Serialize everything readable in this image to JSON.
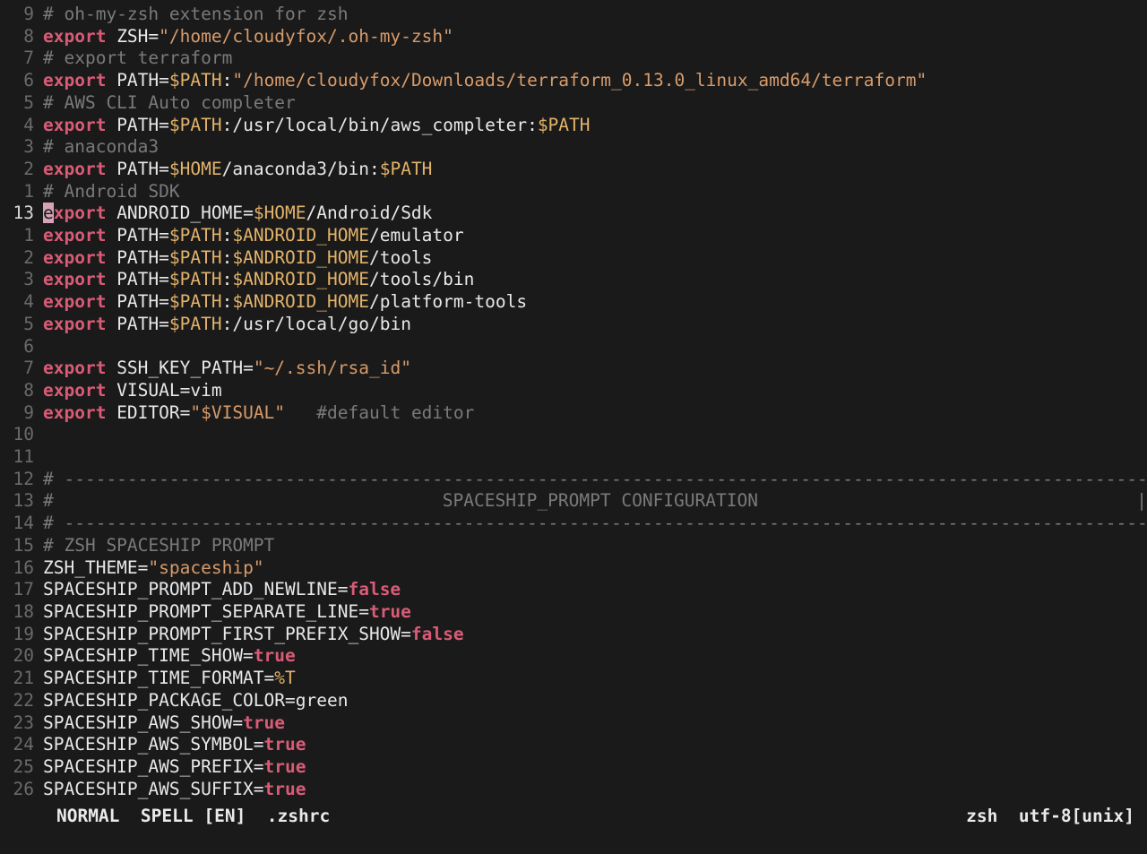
{
  "gutter": {
    "rel_above": [
      "9",
      "8",
      "7",
      "6",
      "5",
      "4",
      "3",
      "2",
      "1"
    ],
    "current": "13",
    "rel_below": [
      "1",
      "2",
      "3",
      "4",
      "5",
      "6",
      "7",
      "8",
      "9",
      "10",
      "11",
      "12",
      "13",
      "14",
      "15",
      "16",
      "17",
      "18",
      "19",
      "20",
      "21",
      "22",
      "23",
      "24",
      "25",
      "26"
    ]
  },
  "lines": {
    "l0": {
      "cm": "# oh-my-zsh extension for zsh"
    },
    "l1": {
      "kw": "export",
      "txt": " ZSH=",
      "str": "\"/home/cloudyfox/.oh-my-zsh\""
    },
    "l2": {
      "cm": "# export terraform"
    },
    "l3": {
      "kw": "export",
      "txt1": " PATH=",
      "var1": "$PATH",
      "txt2": ":",
      "str": "\"/home/cloudyfox/Downloads/terraform_0.13.0_linux_amd64/terraform\""
    },
    "l4": {
      "cm": "# AWS CLI Auto completer"
    },
    "l5": {
      "kw": "export",
      "txt1": " PATH=",
      "var1": "$PATH",
      "txt2": ":/usr/local/bin/aws_completer:",
      "var2": "$PATH"
    },
    "l6": {
      "cm": "# anaconda3"
    },
    "l7": {
      "kw": "export",
      "txt1": " PATH=",
      "var1": "$HOME",
      "txt2": "/anaconda3/bin:",
      "var2": "$PATH"
    },
    "l8": {
      "cm": "# Android SDK"
    },
    "l9": {
      "cur": "e",
      "kw": "xport",
      "txt1": " ANDROID_HOME=",
      "var1": "$HOME",
      "txt2": "/Android/Sdk"
    },
    "l10": {
      "kw": "export",
      "txt1": " PATH=",
      "var1": "$PATH",
      "txt2": ":",
      "var2": "$ANDROID_HOME",
      "txt3": "/emulator"
    },
    "l11": {
      "kw": "export",
      "txt1": " PATH=",
      "var1": "$PATH",
      "txt2": ":",
      "var2": "$ANDROID_HOME",
      "txt3": "/tools"
    },
    "l12": {
      "kw": "export",
      "txt1": " PATH=",
      "var1": "$PATH",
      "txt2": ":",
      "var2": "$ANDROID_HOME",
      "txt3": "/tools/bin"
    },
    "l13": {
      "kw": "export",
      "txt1": " PATH=",
      "var1": "$PATH",
      "txt2": ":",
      "var2": "$ANDROID_HOME",
      "txt3": "/platform-tools"
    },
    "l14": {
      "kw": "export",
      "txt1": " PATH=",
      "var1": "$PATH",
      "txt2": ":/usr/local/go/bin"
    },
    "l15": {
      "blank": " "
    },
    "l16": {
      "kw": "export",
      "txt1": " SSH_KEY_PATH=",
      "str": "\"~/.ssh/rsa_id\""
    },
    "l17": {
      "kw": "export",
      "txt1": " VISUAL=vim"
    },
    "l18": {
      "kw": "export",
      "txt1": " EDITOR=",
      "str": "\"$VISUAL\"",
      "sp": "   ",
      "cm": "#default editor"
    },
    "l19": {
      "blank": " "
    },
    "l20": {
      "blank": " "
    },
    "l21": {
      "hash": "# "
    },
    "l22": {
      "hash": "# ",
      "center": "SPACESHIP_PROMPT CONFIGURATION",
      "right": "|"
    },
    "l23": {
      "hash": "# "
    },
    "l24": {
      "cm": "# ZSH SPACESHIP PROMPT"
    },
    "l25": {
      "txt": "ZSH_THEME=",
      "str": "\"spaceship\""
    },
    "l26": {
      "txt": "SPACESHIP_PROMPT_ADD_NEWLINE=",
      "bool": "false"
    },
    "l27": {
      "txt": "SPACESHIP_PROMPT_SEPARATE_LINE=",
      "bool": "true"
    },
    "l28": {
      "txt": "SPACESHIP_PROMPT_FIRST_PREFIX_SHOW=",
      "bool": "false"
    },
    "l29": {
      "txt": "SPACESHIP_TIME_SHOW=",
      "bool": "true"
    },
    "l30": {
      "txt": "SPACESHIP_TIME_FORMAT=",
      "var": "%T"
    },
    "l31": {
      "txt": "SPACESHIP_PACKAGE_COLOR=green"
    },
    "l32": {
      "txt": "SPACESHIP_AWS_SHOW=",
      "bool": "true"
    },
    "l33": {
      "txt": "SPACESHIP_AWS_SYMBOL=",
      "bool": "true"
    },
    "l34": {
      "txt": "SPACESHIP_AWS_PREFIX=",
      "bool": "true"
    },
    "l35": {
      "txt": "SPACESHIP_AWS_SUFFIX=",
      "bool": "true"
    }
  },
  "statusbar": {
    "mode": "NORMAL",
    "spell": "SPELL [EN]",
    "file": ".zshrc",
    "filetype": "zsh",
    "encoding": "utf-8[unix]"
  }
}
